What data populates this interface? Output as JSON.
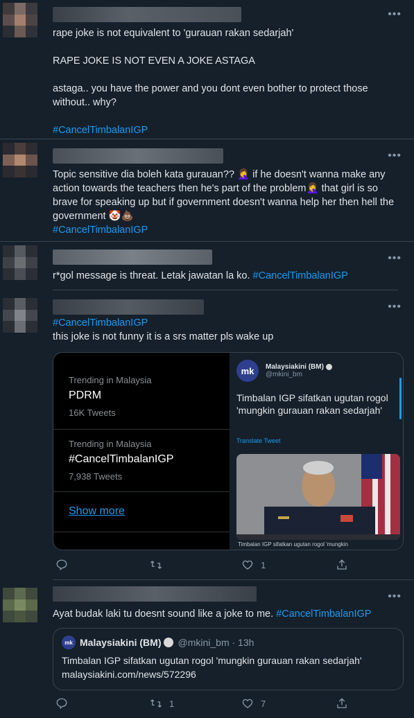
{
  "tweets": [
    {
      "paragraphs": [
        "rape joke is not equivalent to 'gurauan rakan sedarjah'",
        "RAPE JOKE IS NOT EVEN A JOKE ASTAGA",
        "astaga.. you have the power and you dont even bother to protect those without.. why?"
      ],
      "hashtag": "#CancelTimbalanIGP"
    },
    {
      "line1": "Topic sensitive dia boleh kata gurauan?? 🤦‍♀️ if he doesn't wanna make any action towards the teachers then he's part of the problem🤦‍♀️ that girl is so brave for speaking up but if government doesn't wanna help her then hell the government 🤡💩",
      "hashtag": "#CancelTimbalanIGP"
    },
    {
      "text": "r*gol message is threat. Letak jawatan la ko. ",
      "hashtag": "#CancelTimbalanIGP"
    },
    {
      "hashtag": "#CancelTimbalanIGP",
      "text": "this joke is not funny it is a srs matter pls wake up",
      "card": {
        "trends": [
          {
            "label": "Trending in Malaysia",
            "name": "PDRM",
            "count": "16K Tweets"
          },
          {
            "label": "Trending in Malaysia",
            "name": "#CancelTimbalanIGP",
            "count": "7,938 Tweets"
          }
        ],
        "show_more": "Show more",
        "news": {
          "logo_text": "mk",
          "account_name": "Malaysiakini (BM)",
          "handle": "@mkini_bm",
          "headline": "Timbalan IGP sifatkan ugutan rogol 'mungkin gurauan rakan sedarjah'",
          "translate": "Translate Tweet",
          "caption": "Timbalan IGP sifatkan ugutan rogol 'mungkin"
        }
      },
      "actions": {
        "reply": "",
        "retweet": "",
        "like": "1",
        "share": ""
      }
    },
    {
      "text": "Ayat budak laki tu doesnt sound like a joke to me. ",
      "hashtag": "#CancelTimbalanIGP",
      "quote": {
        "logo_text": "mk",
        "account_name": "Malaysiakini (BM)",
        "handle": "@mkini_bm · 13h",
        "body": "Timbalan IGP sifatkan ugutan rogol 'mungkin gurauan rakan sedarjah' malaysiakini.com/news/572296"
      },
      "actions": {
        "reply": "",
        "retweet": "1",
        "like": "7",
        "share": ""
      }
    }
  ],
  "colors": {
    "background": "#15202b",
    "link": "#1d9bf0",
    "muted": "#8899a6",
    "border": "#38444d"
  },
  "icons": [
    "reply-icon",
    "retweet-icon",
    "like-icon",
    "share-icon",
    "more-icon",
    "verified-icon"
  ]
}
